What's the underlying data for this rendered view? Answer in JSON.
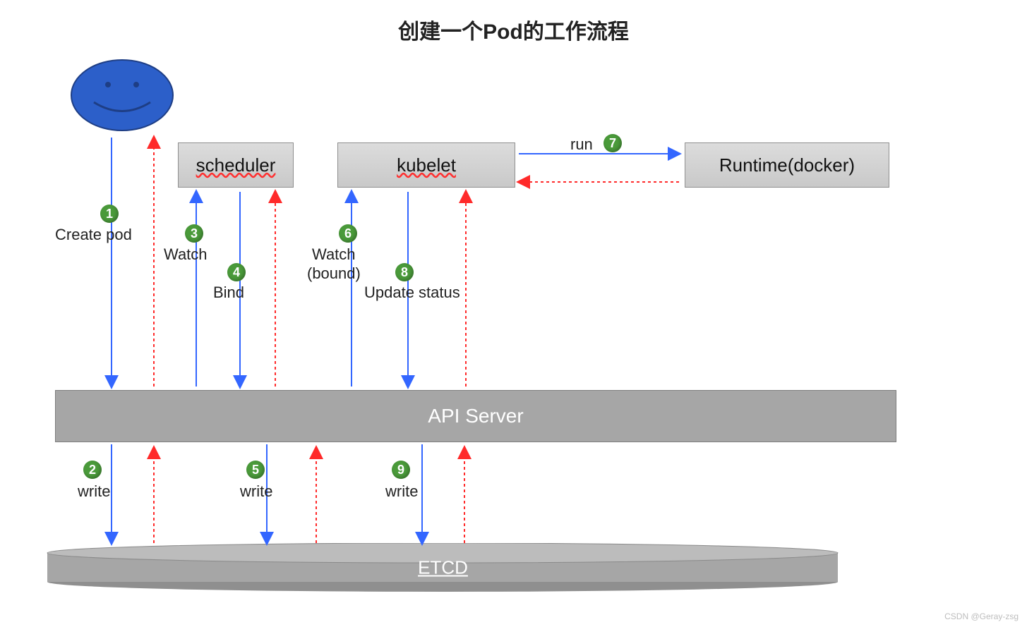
{
  "title": "创建一个Pod的工作流程",
  "nodes": {
    "scheduler": "scheduler",
    "kubelet": "kubelet",
    "runtime": "Runtime(docker)",
    "api": "API Server",
    "etcd": "ETCD"
  },
  "labels": {
    "create_pod": "Create pod",
    "watch": "Watch",
    "bind": "Bind",
    "watch_bound_l1": "Watch",
    "watch_bound_l2": "(bound)",
    "update_status": "Update status",
    "run": "run",
    "write": "write"
  },
  "steps": {
    "s1": "1",
    "s2": "2",
    "s3": "3",
    "s4": "4",
    "s5": "5",
    "s6": "6",
    "s7": "7",
    "s8": "8",
    "s9": "9"
  },
  "watermark": "CSDN @Geray-zsg",
  "colors": {
    "badge": "#4a9a3a",
    "blue": "#3366ff",
    "red": "#ff2a2a",
    "grey": "#a6a6a6"
  }
}
